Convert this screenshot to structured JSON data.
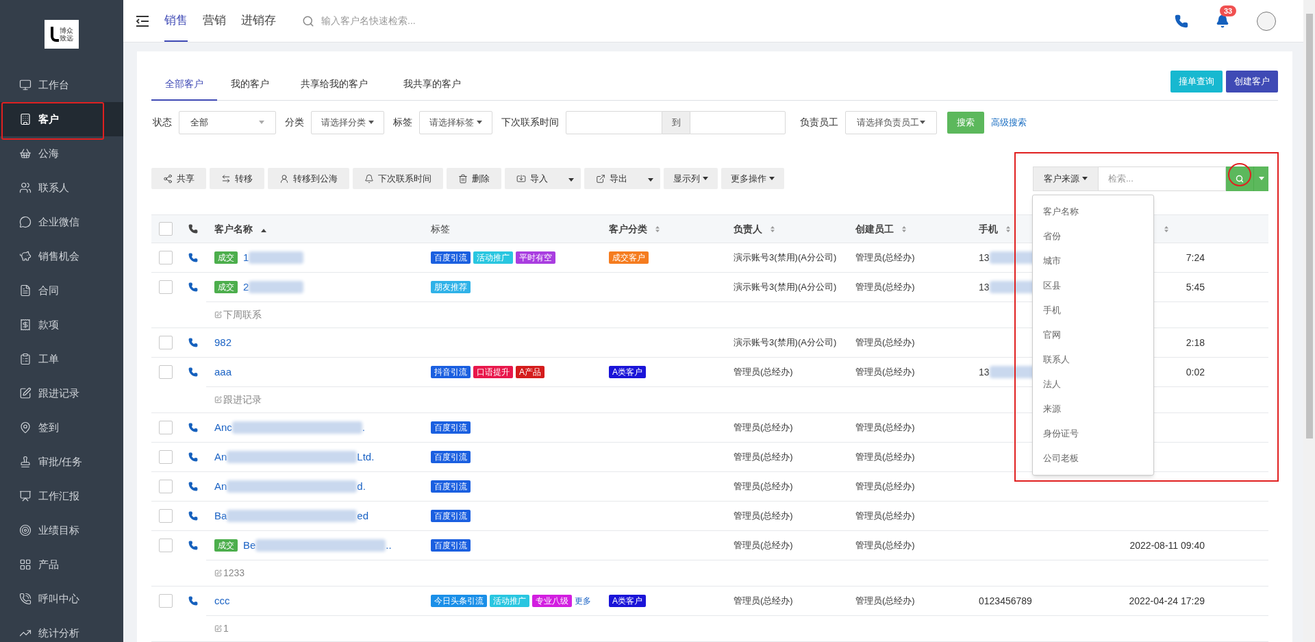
{
  "logo": {
    "text_1": "博众",
    "text_2": "致远"
  },
  "sidebar": {
    "items": [
      {
        "label": "工作台",
        "selected": false
      },
      {
        "label": "客户",
        "selected": true
      },
      {
        "label": "公海",
        "selected": false
      },
      {
        "label": "联系人",
        "selected": false
      },
      {
        "label": "企业微信",
        "selected": false
      },
      {
        "label": "销售机会",
        "selected": false
      },
      {
        "label": "合同",
        "selected": false
      },
      {
        "label": "款项",
        "selected": false
      },
      {
        "label": "工单",
        "selected": false
      },
      {
        "label": "跟进记录",
        "selected": false
      },
      {
        "label": "签到",
        "selected": false
      },
      {
        "label": "审批/任务",
        "selected": false
      },
      {
        "label": "工作汇报",
        "selected": false
      },
      {
        "label": "业绩目标",
        "selected": false
      },
      {
        "label": "产品",
        "selected": false
      },
      {
        "label": "呼叫中心",
        "selected": false
      },
      {
        "label": "统计分析",
        "selected": false
      }
    ]
  },
  "topbar": {
    "tabs": [
      {
        "label": "销售",
        "selected": true
      },
      {
        "label": "营销",
        "selected": false
      },
      {
        "label": "进销存",
        "selected": false
      }
    ],
    "search_placeholder": "输入客户名快速检索...",
    "notification_count": "33"
  },
  "tabs": [
    {
      "label": "全部客户",
      "selected": true
    },
    {
      "label": "我的客户",
      "selected": false
    },
    {
      "label": "共享给我的客户",
      "selected": false
    },
    {
      "label": "我共享的客户",
      "selected": false
    }
  ],
  "header_buttons": [
    {
      "label": "撞单查询",
      "color": "#17b8d0"
    },
    {
      "label": "创建客户",
      "color": "#3f4ab5"
    }
  ],
  "filters": {
    "status_label": "状态",
    "status_value": "全部",
    "category_label": "分类",
    "category_placeholder": "请选择分类",
    "tag_label": "标签",
    "tag_placeholder": "请选择标签",
    "next_contact_label": "下次联系时间",
    "range_separator": "到",
    "owner_label": "负责员工",
    "owner_placeholder": "请选择负责员工",
    "search_button": "搜索",
    "advanced_link": "高级搜索"
  },
  "toolbar": [
    {
      "label": "共享",
      "kind": "plain"
    },
    {
      "label": "转移",
      "kind": "plain"
    },
    {
      "label": "转移到公海",
      "kind": "plain"
    },
    {
      "label": "下次联系时间",
      "kind": "plain"
    },
    {
      "label": "删除",
      "kind": "plain"
    },
    {
      "label": "导入",
      "kind": "split"
    },
    {
      "label": "导出",
      "kind": "split"
    },
    {
      "label": "显示列",
      "kind": "menu"
    },
    {
      "label": "更多操作",
      "kind": "menu"
    }
  ],
  "field_search": {
    "field": "客户来源",
    "placeholder": "检索...",
    "open": true,
    "options": [
      "客户名称",
      "省份",
      "城市",
      "区县",
      "手机",
      "官网",
      "联系人",
      "法人",
      "来源",
      "身份证号",
      "公司老板"
    ]
  },
  "table": {
    "all_checked": false,
    "columns": [
      {
        "label": "客户名称",
        "sortable": true,
        "sorted_ascending": true
      },
      {
        "label": "标签",
        "sortable": false
      },
      {
        "label": "客户分类",
        "sortable": true
      },
      {
        "label": "负责人",
        "sortable": true
      },
      {
        "label": "创建员工",
        "sortable": true
      },
      {
        "label": "手机",
        "sortable": true
      },
      {
        "sortable": true
      }
    ],
    "rows": [
      {
        "checked": false,
        "deal": true,
        "deal_label": "成交",
        "name": "1",
        "name_blurred": true,
        "tags": [
          {
            "label": "百度引流",
            "color": "#1a5fe0"
          },
          {
            "label": "活动推广",
            "color": "#29c6e0"
          },
          {
            "label": "平时有空",
            "color": "#a93de0"
          }
        ],
        "category": {
          "label": "成交客户",
          "color": "#f57c1f"
        },
        "owner": "演示账号3(禁用)(A分公司)",
        "creator": "管理员(总经办)",
        "phone": "13",
        "phone_blurred": true,
        "time": "7:24"
      },
      {
        "checked": false,
        "deal": true,
        "deal_label": "成交",
        "name": "2",
        "name_blurred": true,
        "tags": [
          {
            "label": "朋友推荐",
            "color": "#2fb2e8"
          }
        ],
        "owner": "演示账号3(禁用)(A分公司)",
        "creator": "管理员(总经办)",
        "phone": "13",
        "phone_blurred": true,
        "time": "5:45",
        "note": "下周联系"
      },
      {
        "checked": false,
        "name": "982",
        "tags": [],
        "owner": "演示账号3(禁用)(A分公司)",
        "creator": "管理员(总经办)",
        "time": "2:18"
      },
      {
        "checked": false,
        "name": "aaa",
        "tags": [
          {
            "label": "抖音引流",
            "color": "#1a5fe0"
          },
          {
            "label": "口语提升",
            "color": "#e8174b"
          },
          {
            "label": "A产品",
            "color": "#d41c1c"
          }
        ],
        "category": {
          "label": "A类客户",
          "color": "#1a14d8"
        },
        "owner": "管理员(总经办)",
        "creator": "管理员(总经办)",
        "phone": "13",
        "phone_blurred": true,
        "time": "0:02",
        "note": "跟进记录"
      },
      {
        "checked": false,
        "name": "Anc",
        "name_blurred": true,
        "name_end": ".",
        "tags": [
          {
            "label": "百度引流",
            "color": "#1a5fe0"
          }
        ],
        "owner": "管理员(总经办)",
        "creator": "管理员(总经办)"
      },
      {
        "checked": false,
        "name": "An",
        "name_blurred": true,
        "name_end": "Ltd.",
        "tags": [
          {
            "label": "百度引流",
            "color": "#1a5fe0"
          }
        ],
        "owner": "管理员(总经办)",
        "creator": "管理员(总经办)"
      },
      {
        "checked": false,
        "name": "An",
        "name_blurred": true,
        "name_end": "d.",
        "tags": [
          {
            "label": "百度引流",
            "color": "#1a5fe0"
          }
        ],
        "owner": "管理员(总经办)",
        "creator": "管理员(总经办)"
      },
      {
        "checked": false,
        "name": "Ba",
        "name_blurred": true,
        "name_end": "ed",
        "tags": [
          {
            "label": "百度引流",
            "color": "#1a5fe0"
          }
        ],
        "owner": "管理员(总经办)",
        "creator": "管理员(总经办)"
      },
      {
        "checked": false,
        "deal": true,
        "deal_label": "成交",
        "name": "Be",
        "name_blurred": true,
        "name_end": "..",
        "tags": [
          {
            "label": "百度引流",
            "color": "#1a5fe0"
          }
        ],
        "owner": "管理员(总经办)",
        "creator": "管理员(总经办)",
        "time": "2022-08-11 09:40",
        "note": "1233"
      },
      {
        "checked": false,
        "name": "ccc",
        "tags": [
          {
            "label": "今日头条引流",
            "color": "#1a8fe8"
          },
          {
            "label": "活动推广",
            "color": "#29c6e0"
          },
          {
            "label": "专业八级",
            "color": "#d21ee0"
          }
        ],
        "more": "更多",
        "category": {
          "label": "A类客户",
          "color": "#1a14d8"
        },
        "owner": "管理员(总经办)",
        "creator": "管理员(总经办)",
        "phone": "0123456789",
        "time": "2022-04-24 17:29",
        "note": "1"
      }
    ]
  }
}
